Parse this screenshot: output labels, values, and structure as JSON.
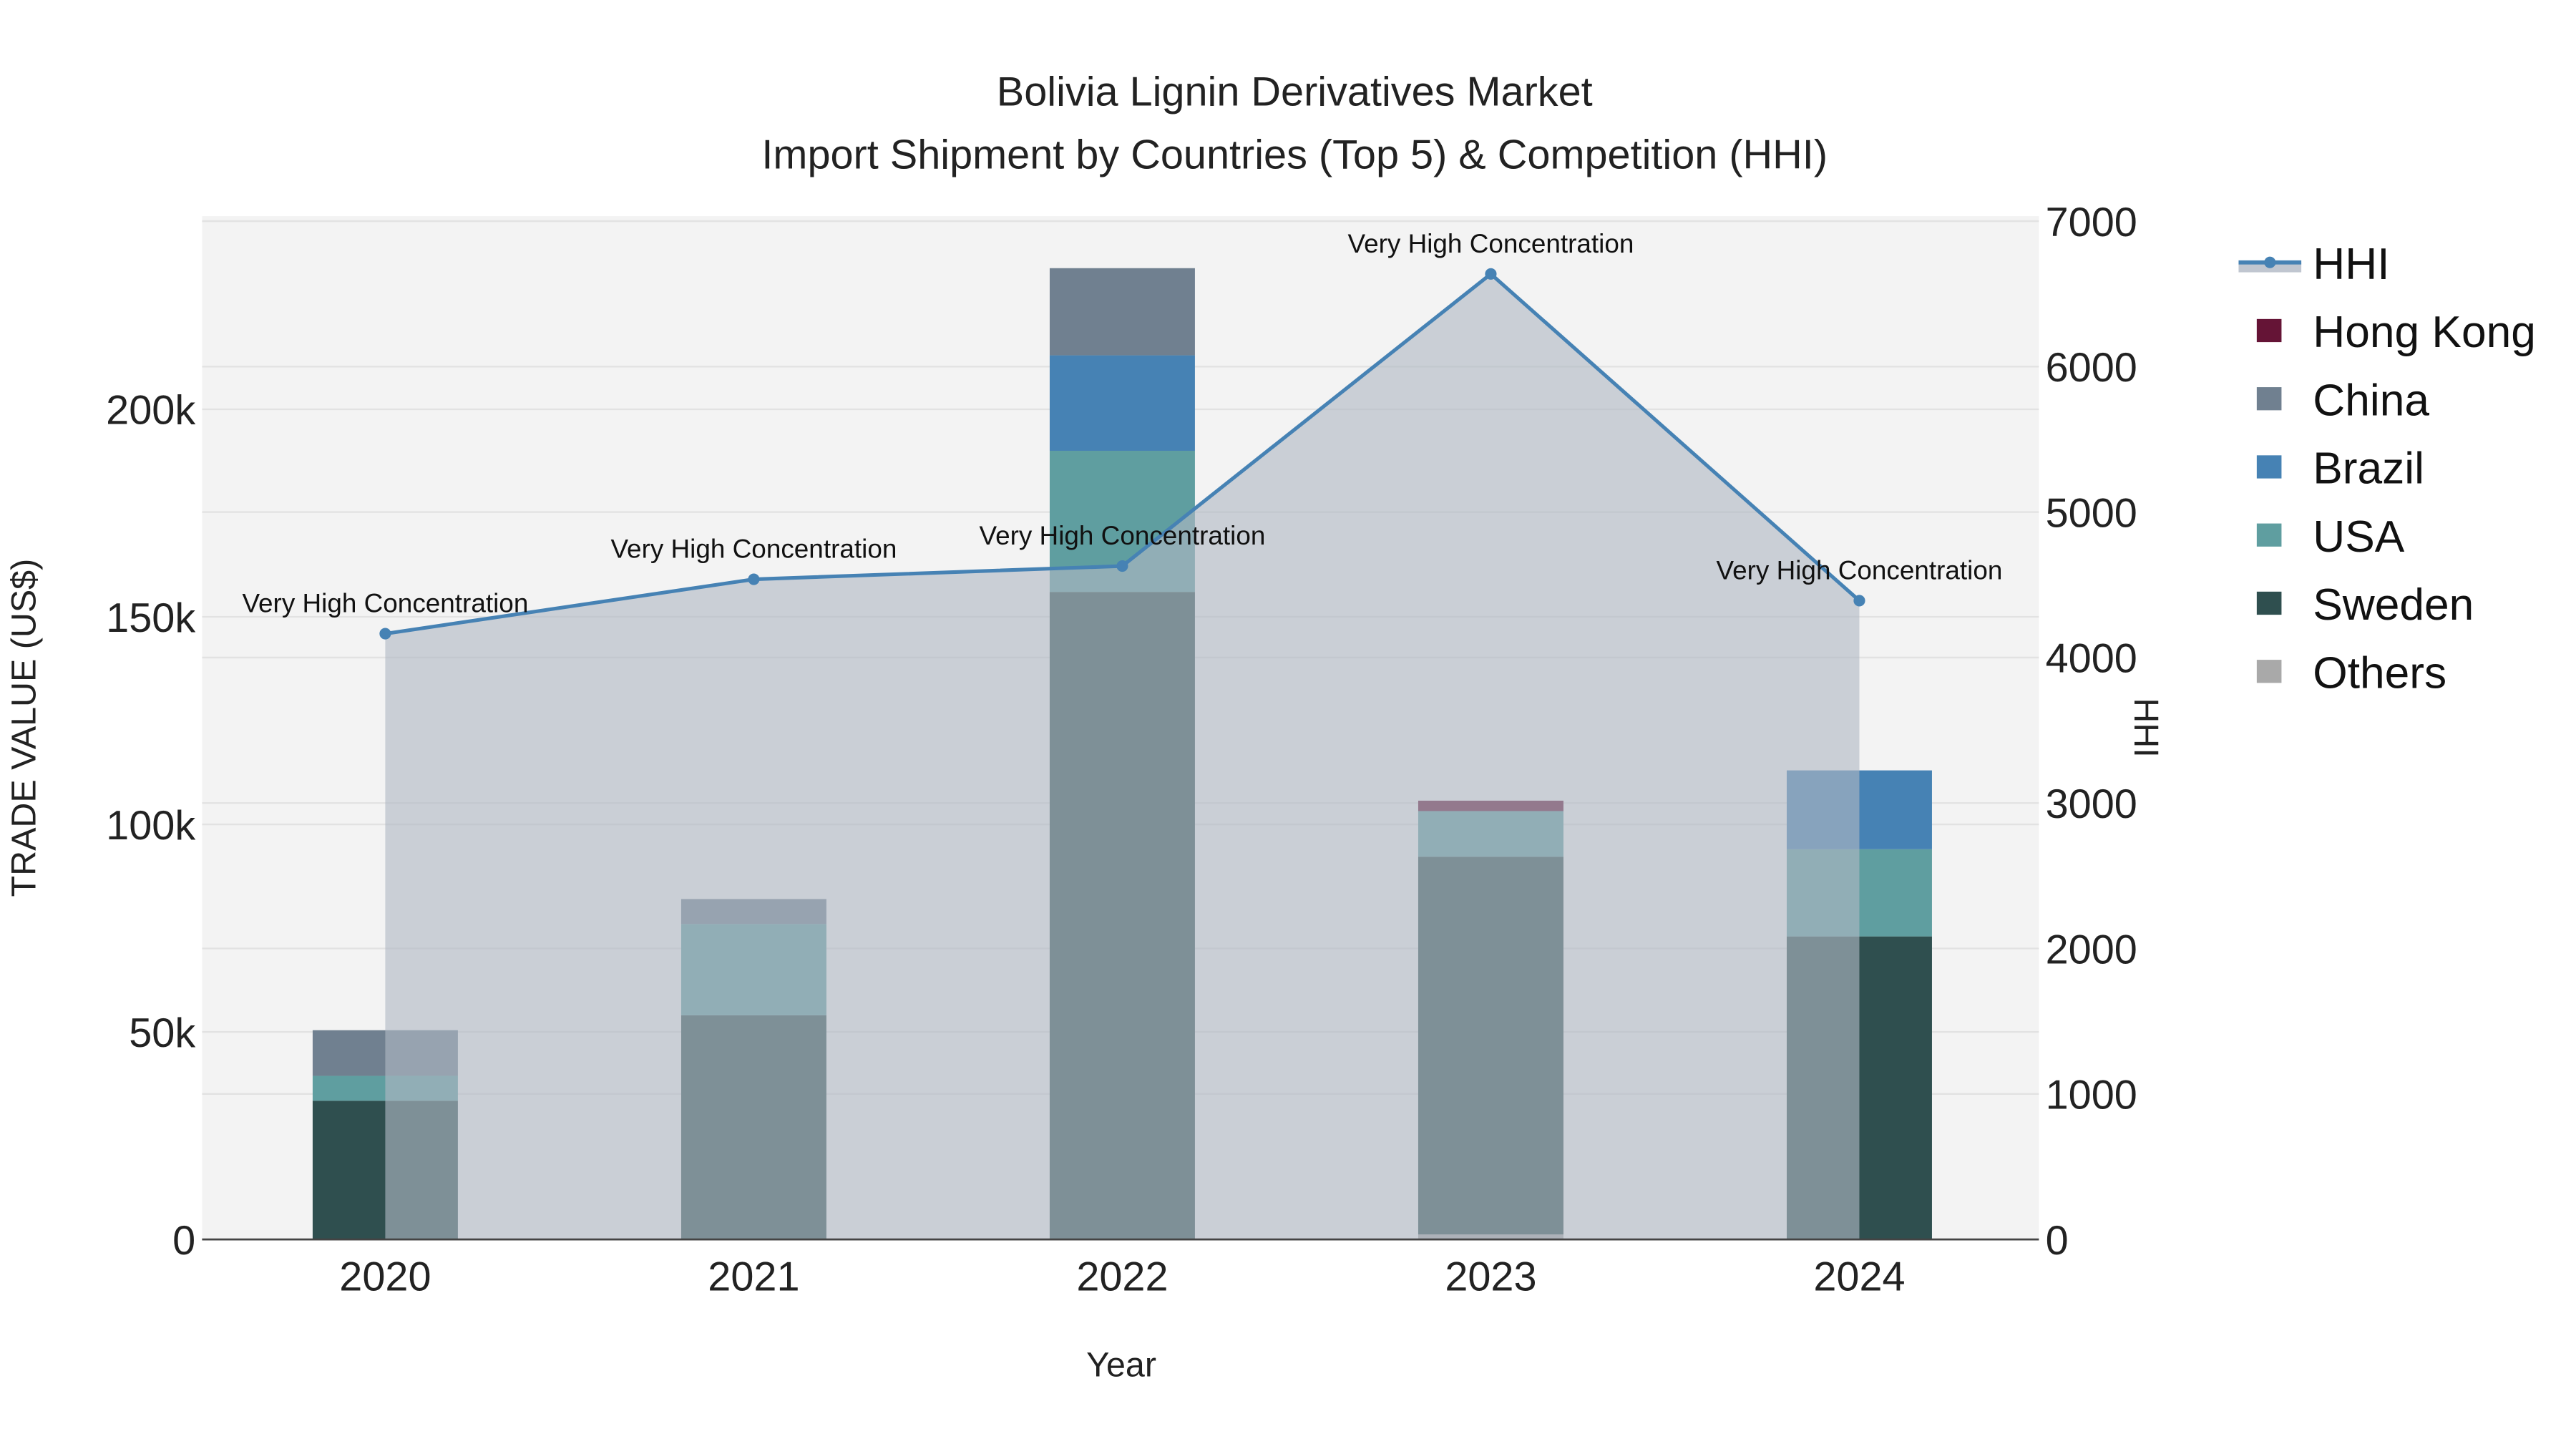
{
  "chart_data": {
    "type": "bar",
    "title": "Bolivia Lignin Derivatives Market",
    "subtitle": "Import Shipment by Countries (Top 5) & Competition (HHI)",
    "xlabel": "Year",
    "ylabel": "TRADE VALUE (US$)",
    "y2label": "HHI",
    "categories": [
      "2020",
      "2021",
      "2022",
      "2023",
      "2024"
    ],
    "ylim": [
      0,
      246000
    ],
    "y2lim": [
      0,
      7000
    ],
    "yticks": [
      {
        "v": 0,
        "label": "0"
      },
      {
        "v": 50000,
        "label": "50k"
      },
      {
        "v": 100000,
        "label": "100k"
      },
      {
        "v": 150000,
        "label": "150k"
      },
      {
        "v": 200000,
        "label": "200k"
      }
    ],
    "y2ticks": [
      {
        "v": 0,
        "label": "0"
      },
      {
        "v": 1000,
        "label": "1000"
      },
      {
        "v": 2000,
        "label": "2000"
      },
      {
        "v": 3000,
        "label": "3000"
      },
      {
        "v": 4000,
        "label": "4000"
      },
      {
        "v": 5000,
        "label": "5000"
      },
      {
        "v": 6000,
        "label": "6000"
      },
      {
        "v": 7000,
        "label": "7000"
      }
    ],
    "series": [
      {
        "name": "Others",
        "color": "#a9a9a9",
        "values": [
          0,
          0,
          0,
          1200,
          0
        ]
      },
      {
        "name": "Sweden",
        "color": "#2f4f4f",
        "values": [
          33400,
          54000,
          156000,
          91000,
          73000
        ]
      },
      {
        "name": "USA",
        "color": "#5f9ea0",
        "values": [
          6000,
          22000,
          34000,
          11000,
          21000
        ]
      },
      {
        "name": "Brazil",
        "color": "#4682b4",
        "values": [
          0,
          0,
          23000,
          0,
          19000
        ]
      },
      {
        "name": "China",
        "color": "#708090",
        "values": [
          11000,
          6000,
          21000,
          0,
          0
        ]
      },
      {
        "name": "Hong Kong",
        "color": "#651436",
        "values": [
          0,
          0,
          0,
          2500,
          0
        ]
      }
    ],
    "hhi": {
      "name": "HHI",
      "color": "#4682b4",
      "values": [
        4164,
        4538,
        4629,
        6637,
        4391
      ],
      "annotations": [
        "Very High Concentration",
        "Very High Concentration",
        "Very High Concentration",
        "Very High Concentration",
        "Very High Concentration"
      ]
    },
    "legend": [
      "HHI",
      "Hong Kong",
      "China",
      "Brazil",
      "USA",
      "Sweden",
      "Others"
    ],
    "legend_position": "right",
    "grid": true
  }
}
